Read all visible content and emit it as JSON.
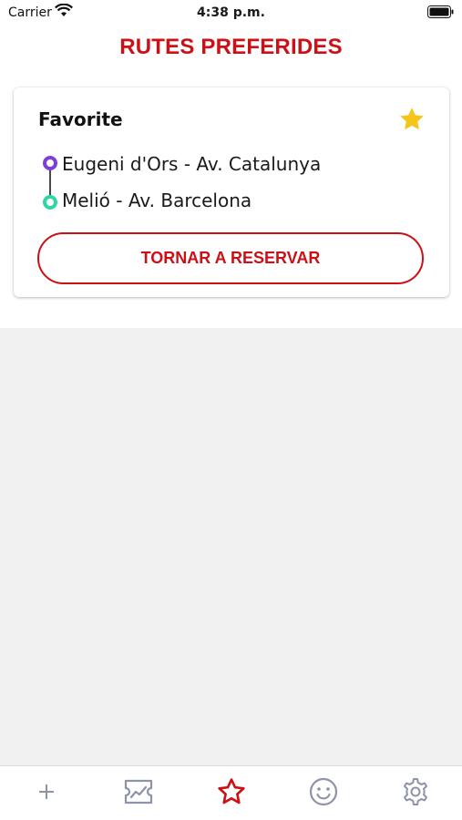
{
  "status_bar": {
    "carrier": "Carrier",
    "time": "4:38 p.m."
  },
  "header": {
    "title": "RUTES PREFERIDES"
  },
  "favorite_card": {
    "title": "Favorite",
    "origin": "Eugeni d'Ors - Av. Catalunya",
    "destination": "Melió - Av. Barcelona",
    "rebook_label": "TORNAR A RESERVAR",
    "starred": true
  },
  "tab_bar": {
    "items": [
      {
        "icon": "plus-icon",
        "active": false
      },
      {
        "icon": "ticket-icon",
        "active": false
      },
      {
        "icon": "star-icon",
        "active": true
      },
      {
        "icon": "smiley-icon",
        "active": false
      },
      {
        "icon": "gear-icon",
        "active": false
      }
    ]
  },
  "colors": {
    "brand_red": "#cc1016",
    "origin_purple": "#7b3fe0",
    "destination_green": "#2ed6a6",
    "star_yellow": "#f5c518",
    "inactive_tab": "#8e93a8"
  }
}
